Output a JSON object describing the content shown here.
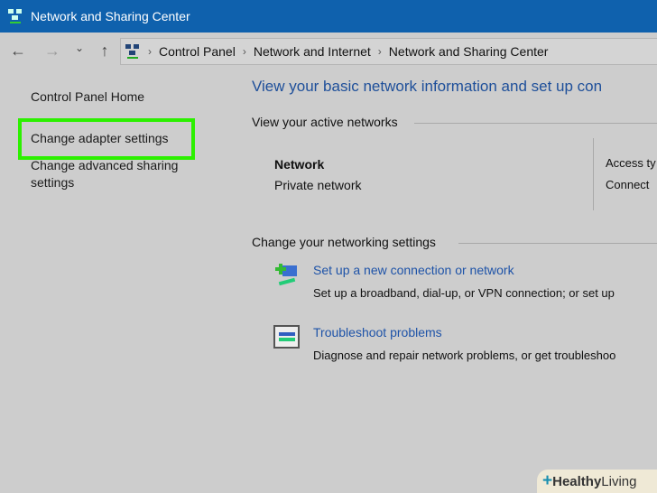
{
  "window": {
    "title": "Network and Sharing Center",
    "icon": "network-icon"
  },
  "nav": {
    "back": "←",
    "forward": "→",
    "recent": "⌄",
    "up": "↑",
    "breadcrumb": [
      "Control Panel",
      "Network and Internet",
      "Network and Sharing Center"
    ]
  },
  "sidebar": {
    "items": [
      {
        "label": "Control Panel Home"
      },
      {
        "label": "Change adapter settings",
        "highlighted": true
      },
      {
        "label": "Change advanced sharing settings"
      }
    ]
  },
  "main": {
    "heading": "View your basic network information and set up con",
    "active_title": "View your active networks",
    "network": {
      "name": "Network",
      "type": "Private network",
      "access_label": "Access ty",
      "connections_label": "Connect"
    },
    "change_title": "Change your networking settings",
    "tasks": [
      {
        "icon": "new-connection-icon",
        "title": "Set up a new connection or network",
        "desc": "Set up a broadband, dial-up, or VPN connection; or set up"
      },
      {
        "icon": "troubleshoot-icon",
        "title": "Troubleshoot problems",
        "desc": "Diagnose and repair network problems, or get troubleshoo"
      }
    ]
  },
  "watermark": {
    "bold": "Healthy",
    "rest": " Living"
  },
  "colors": {
    "titlebar": "#0f61ad",
    "highlight": "#2cf000",
    "link": "#1e53a8"
  }
}
